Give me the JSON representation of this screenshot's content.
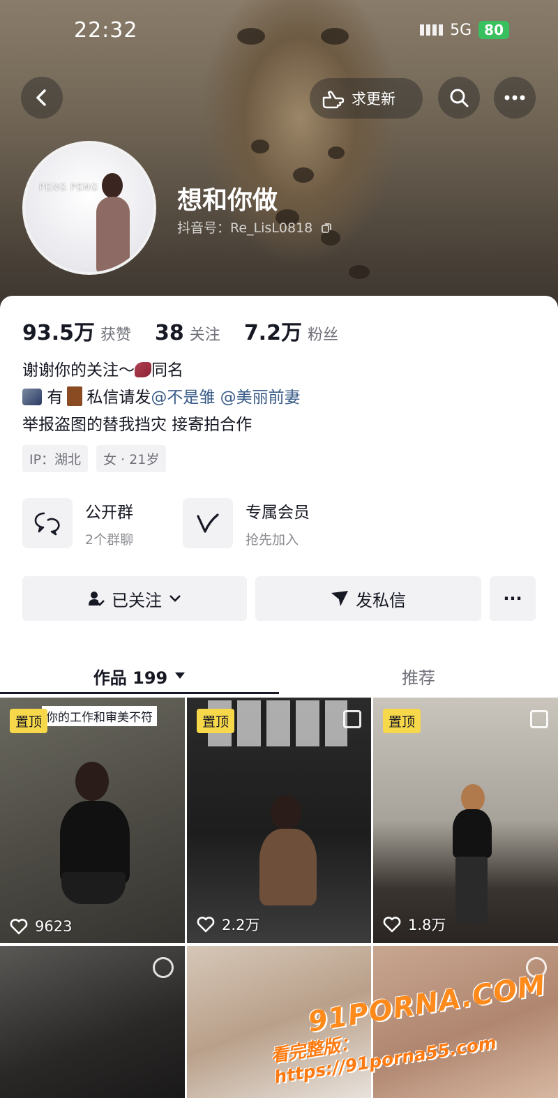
{
  "status_bar": {
    "time": "22:32",
    "network": "5G",
    "battery": "80"
  },
  "header": {
    "request_update_label": "求更新",
    "back_icon": "back-arrow-icon",
    "search_icon": "search-icon",
    "more_icon": "more-dots-icon"
  },
  "profile": {
    "avatar_text": "PENG PENG",
    "nickname": "想和你做",
    "douyin_id": "抖音号：Re_LisL0818"
  },
  "stats": [
    {
      "value": "93.5万",
      "label": "获赞"
    },
    {
      "value": "38",
      "label": "关注"
    },
    {
      "value": "7.2万",
      "label": "粉丝"
    }
  ],
  "bio": {
    "line1_text": "谢谢你的关注～",
    "line1_suffix": "同名",
    "line2_have": "有",
    "line2_prefix": "私信请发",
    "mention1": "@不是雏",
    "mention2": "@美丽前妻",
    "line3": "举报盗图的替我挡灾  接寄拍合作"
  },
  "tags": [
    "IP：湖北",
    "女 · 21岁"
  ],
  "features": [
    {
      "title": "公开群",
      "subtitle": "2个群聊",
      "icon": "group-chat-icon"
    },
    {
      "title": "专属会员",
      "subtitle": "抢先加入",
      "icon": "membership-v-icon"
    }
  ],
  "actions": {
    "follow_label": "已关注",
    "message_label": "发私信",
    "more_label": "···"
  },
  "tabs": {
    "works_label": "作品 199",
    "recommend_label": "推荐"
  },
  "posts": [
    {
      "pinned": "置顶",
      "caption": "你的工作和审美不符",
      "likes": "9623"
    },
    {
      "pinned": "置顶",
      "likes": "2.2万"
    },
    {
      "pinned": "置顶",
      "likes": "1.8万"
    },
    {},
    {},
    {}
  ],
  "watermark": {
    "line1": "91PORNA.COM",
    "line2": "看完整版：https://91porna55.com"
  },
  "colors": {
    "pin_bg": "#f7d84a",
    "battery_bg": "#39c05e",
    "mention": "#3a5c88",
    "watermark": "#ff8a1c"
  }
}
